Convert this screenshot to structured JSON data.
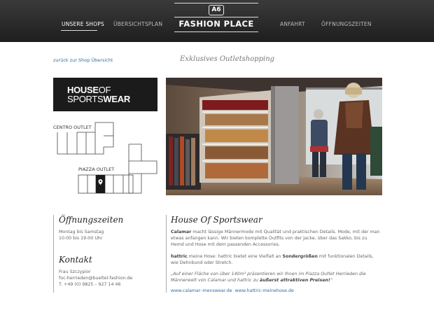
{
  "nav": {
    "items": [
      {
        "label": "UNSERE SHOPS",
        "active": true
      },
      {
        "label": "ÜBERSICHTSPLAN",
        "active": false
      },
      {
        "label": "ANFAHRT",
        "active": false
      },
      {
        "label": "ÖFFNUNGSZEITEN",
        "active": false
      }
    ]
  },
  "logo": {
    "badge": "A6",
    "wordmark": "FASHION PLACE"
  },
  "subheader": {
    "back_link": "zurück zur Shop Übersicht",
    "tagline": "Exklusives Outletshopping"
  },
  "brand_logo": {
    "house": "HOUSE",
    "of": "OF",
    "sports": "SPORTS",
    "wear": "WEAR"
  },
  "map": {
    "label_centro": "CENTRO OUTLET",
    "label_piazza": "PIAZZA OUTLET",
    "marker_icon": "location-pin-icon"
  },
  "hours": {
    "title": "Öffnungszeiten",
    "line1": "Montag bis Samstag",
    "line2": "10:00 bis 19:00 Uhr"
  },
  "contact": {
    "title": "Kontakt",
    "name": "Frau Szczypior",
    "email": "foc-herrieden@bueltel-fashion.de",
    "phone": "T. +49 (0) 9825 – 927 14 46"
  },
  "shop": {
    "title": "House Of Sportswear",
    "p1_brand": "Calamar",
    "p1_text": " macht lässige Männermode mit Qualität und praktischen Details. Mode, mit der man etwas anfangen kann. Wir bieten komplette Outfits von der Jacke, über das Sakko, bis zu Hemd und Hose mit dem  passenden Accessories.",
    "p2_brand": "hattric",
    "p2_text_a": " meine Hose: hattric bietet eine Vielfalt an ",
    "p2_bold": "Sondergrößen",
    "p2_text_b": " mit funktionalen Details, wie Dehnbund oder Stretch.",
    "quote_a": "„Auf einer Fläche von über 140m² präsentieren wir Ihnen im  Piazza Outlet  Herrieden  die Männerwelt von Calamar und hattric  zu ",
    "quote_bold": "äußerst  attraktiven Preisen!",
    "quote_end": "“",
    "link1": "www.calamar–menswear.de",
    "link2": "www.hattric-meinehose.de"
  }
}
